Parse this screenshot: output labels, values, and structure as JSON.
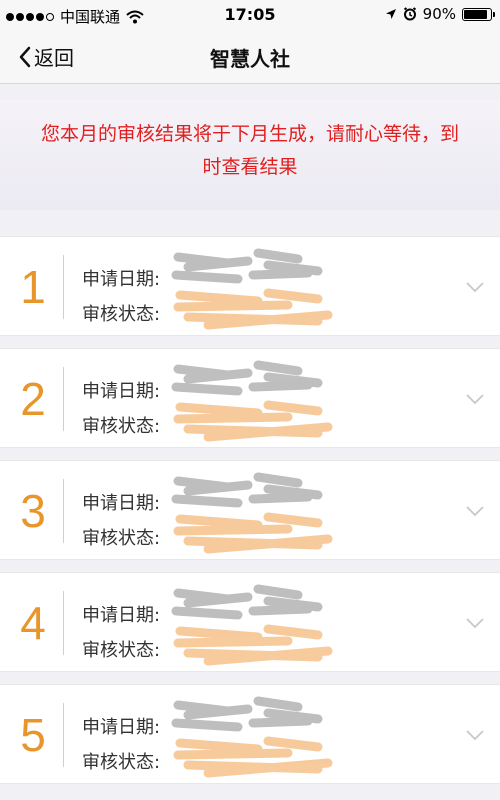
{
  "status_bar": {
    "carrier": "中国联通",
    "time": "17:05",
    "battery_percent": "90%",
    "battery_level": 0.9
  },
  "nav": {
    "back_label": "返回",
    "title": "智慧人社"
  },
  "notice": {
    "line1": "您本月的审核结果将于下月生成，请耐心等待，到",
    "line2": "时查看结果"
  },
  "records": [
    {
      "number": "1",
      "date_label": "申请日期:",
      "status_label": "审核状态:"
    },
    {
      "number": "2",
      "date_label": "申请日期:",
      "status_label": "审核状态:"
    },
    {
      "number": "3",
      "date_label": "申请日期:",
      "status_label": "审核状态:"
    },
    {
      "number": "4",
      "date_label": "申请日期:",
      "status_label": "审核状态:"
    },
    {
      "number": "5",
      "date_label": "申请日期:",
      "status_label": "审核状态:"
    }
  ],
  "colors": {
    "accent_orange": "#e8952c",
    "notice_red": "#e02020",
    "redaction_gray": "#8a8a8a",
    "redaction_orange": "#f0a04a"
  },
  "icons": {
    "back": "chevron-left-icon",
    "expand": "chevron-down-icon",
    "wifi": "wifi-icon",
    "location": "location-arrow-icon",
    "alarm": "alarm-icon",
    "battery": "battery-icon"
  }
}
